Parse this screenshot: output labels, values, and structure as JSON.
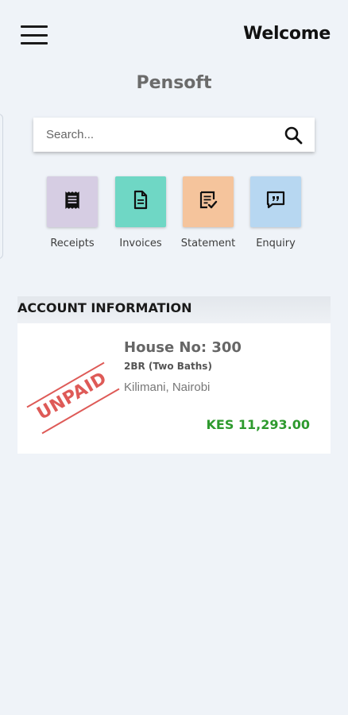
{
  "header": {
    "welcome": "Welcome",
    "app_name": "Pensoft"
  },
  "search": {
    "placeholder": "Search..."
  },
  "quick_actions": [
    {
      "label": "Receipts",
      "icon": "receipt-icon",
      "color": "#d6cde3"
    },
    {
      "label": "Invoices",
      "icon": "invoice-document-icon",
      "color": "#6fd7c5"
    },
    {
      "label": "Statement",
      "icon": "statement-check-icon",
      "color": "#f5c49c"
    },
    {
      "label": "Enquiry",
      "icon": "chat-quote-icon",
      "color": "#b7d7f1"
    }
  ],
  "account": {
    "section_title": "ACCOUNT INFORMATION",
    "status_stamp": "UNPAID",
    "status_color": "#de5a57",
    "house_no": "House No: 300",
    "house_type": "2BR (Two Baths)",
    "location": "Kilimani, Nairobi",
    "amount": "KES 11,293.00",
    "amount_color": "#2e9a2e"
  }
}
